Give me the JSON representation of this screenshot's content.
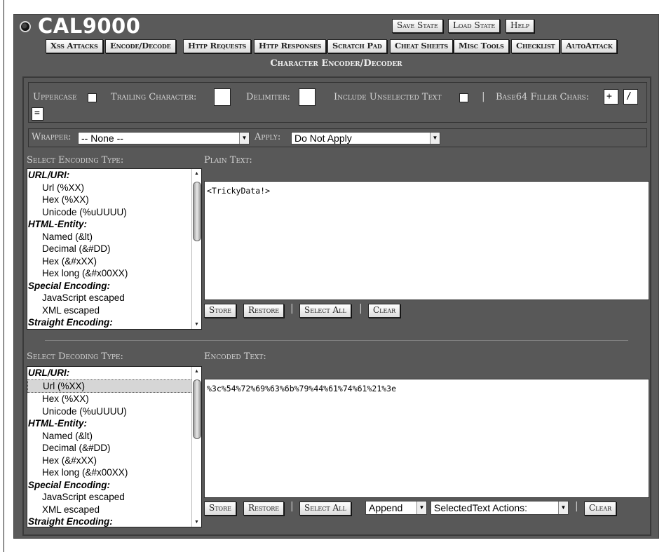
{
  "app": {
    "title": "CAL9000",
    "save_state": "Save State",
    "load_state": "Load State",
    "help": "Help"
  },
  "nav": [
    "Xss Attacks",
    "Encode/Decode",
    "Http Requests",
    "Http Responses",
    "Scratch Pad",
    "Cheat Sheets",
    "Misc Tools",
    "Checklist",
    "AutoAttack"
  ],
  "section_title": "Character Encoder/Decoder",
  "options": {
    "uppercase": "Uppercase",
    "trailing_character": "Trailing Character:",
    "delimiter": "Delimiter:",
    "include_unselected": "Include Unselected Text",
    "separator": "|",
    "base64_filler": "Base64 Filler Chars:",
    "filler_1": "+",
    "filler_2": "/",
    "filler_3": "="
  },
  "wrapper": {
    "label": "Wrapper:",
    "value": "-- None --",
    "apply_label": "Apply:",
    "apply_value": "Do Not Apply"
  },
  "encoding": {
    "label": "Select Encoding Type:",
    "plain_label": "Plain Text:",
    "plain_text": "<TrickyData!>",
    "items": [
      {
        "text": "URL/URI:",
        "type": "grp"
      },
      {
        "text": "Url (%XX)",
        "type": "itm"
      },
      {
        "text": "Hex (%XX)",
        "type": "itm"
      },
      {
        "text": "Unicode (%uUUUU)",
        "type": "itm"
      },
      {
        "text": "HTML-Entity:",
        "type": "grp"
      },
      {
        "text": "Named (&lt)",
        "type": "itm"
      },
      {
        "text": "Decimal (&#DD)",
        "type": "itm"
      },
      {
        "text": "Hex (&#xXX)",
        "type": "itm"
      },
      {
        "text": "Hex long (&#x00XX)",
        "type": "itm"
      },
      {
        "text": "Special Encoding:",
        "type": "grp"
      },
      {
        "text": "JavaScript escaped",
        "type": "itm"
      },
      {
        "text": "XML escaped",
        "type": "itm"
      },
      {
        "text": "Straight Encoding:",
        "type": "grp"
      }
    ],
    "buttons": {
      "store": "Store",
      "restore": "Restore",
      "select_all": "Select All",
      "clear": "Clear",
      "sep": "|"
    }
  },
  "decoding": {
    "label": "Select Decoding Type:",
    "encoded_label": "Encoded Text:",
    "encoded_text": "%3c%54%72%69%63%6b%79%44%61%74%61%21%3e",
    "selected_index": 1,
    "items": [
      {
        "text": "URL/URI:",
        "type": "grp"
      },
      {
        "text": "Url (%XX)",
        "type": "itm"
      },
      {
        "text": "Hex (%XX)",
        "type": "itm"
      },
      {
        "text": "Unicode (%uUUUU)",
        "type": "itm"
      },
      {
        "text": "HTML-Entity:",
        "type": "grp"
      },
      {
        "text": "Named (&lt)",
        "type": "itm"
      },
      {
        "text": "Decimal (&#DD)",
        "type": "itm"
      },
      {
        "text": "Hex (&#xXX)",
        "type": "itm"
      },
      {
        "text": "Hex long (&#x00XX)",
        "type": "itm"
      },
      {
        "text": "Special Encoding:",
        "type": "grp"
      },
      {
        "text": "JavaScript escaped",
        "type": "itm"
      },
      {
        "text": "XML escaped",
        "type": "itm"
      },
      {
        "text": "Straight Encoding:",
        "type": "grp"
      }
    ],
    "buttons": {
      "store": "Store",
      "restore": "Restore",
      "select_all": "Select All",
      "append": "Append",
      "actions": "SelectedText Actions:",
      "clear": "Clear",
      "sep": "|"
    }
  }
}
